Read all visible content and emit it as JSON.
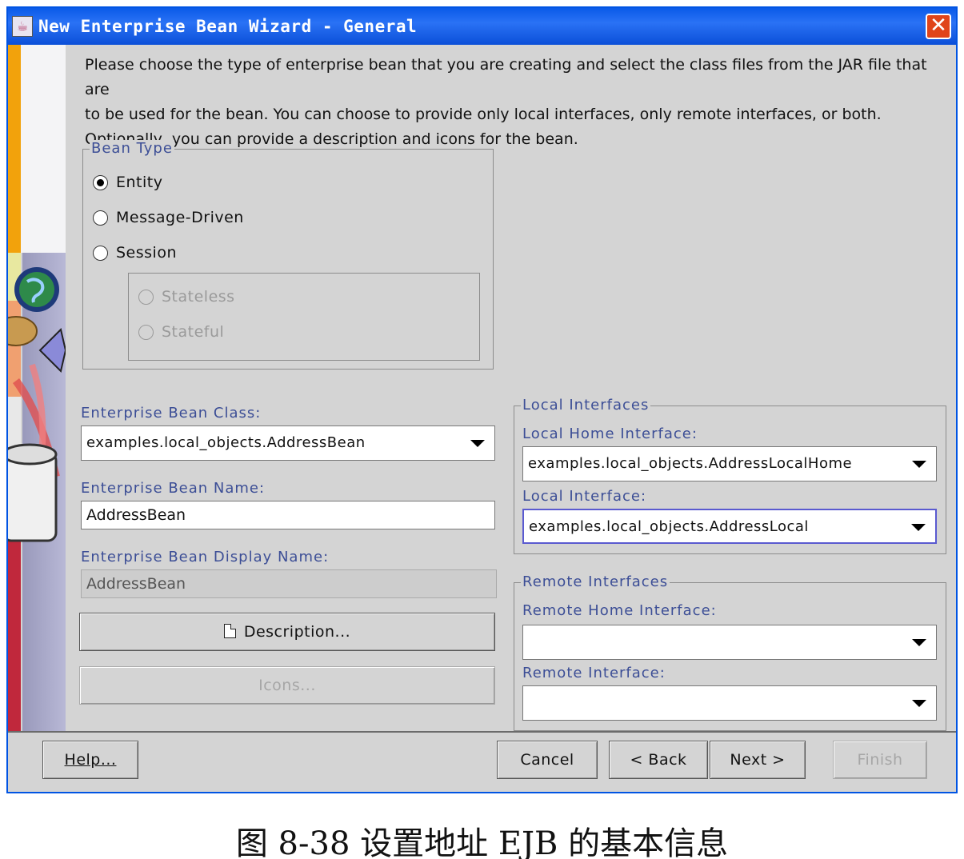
{
  "window": {
    "title": "New Enterprise Bean Wizard - General",
    "close_glyph": "✕",
    "accent_color": "#0054e3"
  },
  "intro": {
    "line1": "Please choose the type of enterprise bean that you are creating and select the class files from the JAR file that are",
    "line2": "to be used for the bean.  You can choose to provide only local interfaces, only remote interfaces, or both.",
    "line3": "Optionally, you can provide a description and icons for the bean."
  },
  "bean_type": {
    "legend": "Bean Type",
    "entity": "Entity",
    "message_driven": "Message-Driven",
    "session": "Session",
    "stateless": "Stateless",
    "stateful": "Stateful",
    "selected": "Entity"
  },
  "left_fields": {
    "class_label": "Enterprise Bean Class:",
    "class_value": "examples.local_objects.AddressBean",
    "name_label": "Enterprise Bean Name:",
    "name_value": "AddressBean",
    "display_label": "Enterprise Bean Display Name:",
    "display_value": "AddressBean",
    "description_button": "Description...",
    "icons_button": "Icons..."
  },
  "local_interfaces": {
    "legend": "Local Interfaces",
    "home_label": "Local Home Interface:",
    "home_value": "examples.local_objects.AddressLocalHome",
    "interface_label": "Local Interface:",
    "interface_value": "examples.local_objects.AddressLocal"
  },
  "remote_interfaces": {
    "legend": "Remote Interfaces",
    "home_label": "Remote Home Interface:",
    "home_value": "",
    "interface_label": "Remote Interface:",
    "interface_value": ""
  },
  "footer": {
    "help": "Help...",
    "cancel": "Cancel",
    "back": "< Back",
    "next": "Next >",
    "finish": "Finish"
  },
  "caption": "图 8-38 设置地址 EJB 的基本信息",
  "icons": {
    "title_icon": "java-cup-icon",
    "description_icon": "document-icon"
  }
}
